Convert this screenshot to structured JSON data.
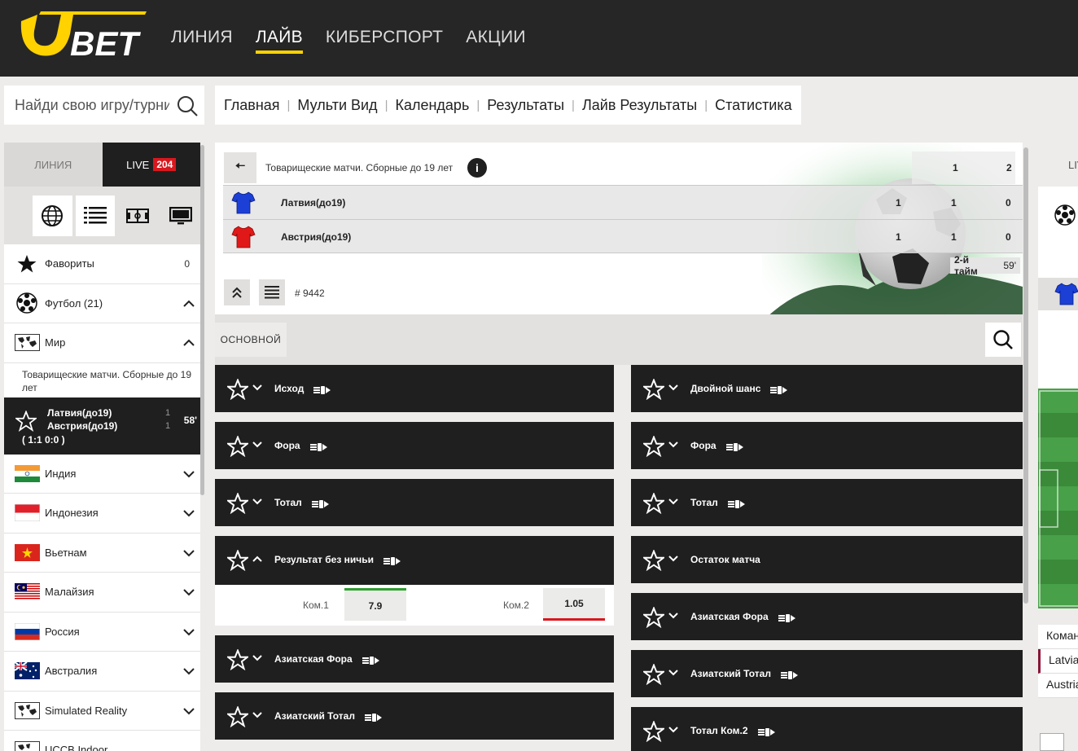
{
  "brand": {
    "logo_text": "UBET",
    "accent": "#ffd200"
  },
  "nav": [
    {
      "label": "ЛИНИЯ",
      "active": false
    },
    {
      "label": "ЛАЙВ",
      "active": true
    },
    {
      "label": "КИБЕРСПОРТ",
      "active": false
    },
    {
      "label": "АКЦИИ",
      "active": false
    }
  ],
  "search": {
    "placeholder": "Найди свою игру/турнир"
  },
  "breadcrumbs": [
    "Главная",
    "Мульти Вид",
    "Календарь",
    "Результаты",
    "Лайв Результаты",
    "Статистика"
  ],
  "sidebar": {
    "tab_line": "ЛИНИЯ",
    "tab_live": "LIVE",
    "live_count": "204",
    "favorites": {
      "label": "Фавориты",
      "count": "0"
    },
    "sport": {
      "label": "Футбол (21)"
    },
    "world": {
      "label": "Мир"
    },
    "tournament": "Товарищеские матчи. Сборные до 19 лет",
    "match": {
      "team1": "Латвия(до19)",
      "team2": "Австрия(до19)",
      "s1": "1",
      "s2": "1",
      "minute": "58'",
      "score": "( 1:1   0:0 )"
    },
    "countries": [
      "Индия",
      "Индонезия",
      "Вьетнам",
      "Малайзия",
      "Россия",
      "Австралия",
      "Simulated Reality",
      "UCCB Indoor"
    ]
  },
  "event": {
    "title": "Товарищеские матчи. Сборные до 19 лет",
    "head": [
      "1",
      "2"
    ],
    "teams": [
      {
        "name": "Латвия(до19)",
        "score": "1",
        "p1": "1",
        "p2": "0",
        "color": "#1c3fd6"
      },
      {
        "name": "Австрия(до19)",
        "score": "1",
        "p1": "1",
        "p2": "0",
        "color": "#e01818"
      }
    ],
    "period": "2-й тайм",
    "minute": "59'",
    "id": "# 9442"
  },
  "filter": {
    "chip": "ОСНОВНОЙ"
  },
  "markets_left": [
    "Исход",
    "Фора",
    "Тотал",
    "Результат без ничьи",
    "Азиатская Фора",
    "Азиатский Тотал"
  ],
  "markets_right": [
    "Двойной шанс",
    "Фора",
    "Тотал",
    "Остаток матча",
    "Азиатская Фора",
    "Азиатский Тотал",
    "Тотал Ком.2"
  ],
  "odds": {
    "k1": "Ком.1",
    "v1": "7.9",
    "k2": "Ком.2",
    "v2": "1.05"
  },
  "right_panel": {
    "tab": "LIVE",
    "rows": [
      "Команда",
      "Latvia",
      "Austria"
    ]
  }
}
